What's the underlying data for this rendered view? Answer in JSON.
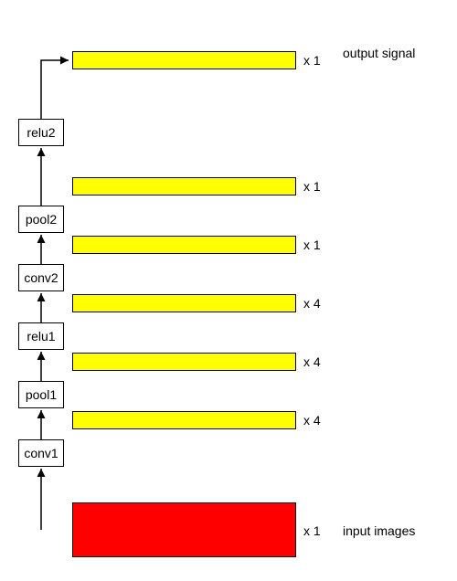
{
  "diagram": {
    "layers": {
      "conv1": "conv1",
      "pool1": "pool1",
      "relu1": "relu1",
      "conv2": "conv2",
      "pool2": "pool2",
      "relu2": "relu2"
    },
    "counts": {
      "input": "x 1",
      "after_conv1": "x 4",
      "after_pool1": "x 4",
      "after_relu1": "x 4",
      "after_conv2": "x 1",
      "after_pool2": "x 1",
      "output": "x 1"
    },
    "captions": {
      "input": "input images",
      "output": "output signal"
    }
  },
  "chart_data": {
    "type": "flow-diagram",
    "direction": "bottom-to-top",
    "nodes": [
      {
        "id": "input",
        "label": "input images",
        "channels": 1,
        "appearance": "large red box"
      },
      {
        "id": "conv1",
        "label": "conv1",
        "output_channels": 4
      },
      {
        "id": "pool1",
        "label": "pool1",
        "output_channels": 4
      },
      {
        "id": "relu1",
        "label": "relu1",
        "output_channels": 4
      },
      {
        "id": "conv2",
        "label": "conv2",
        "output_channels": 1
      },
      {
        "id": "pool2",
        "label": "pool2",
        "output_channels": 1
      },
      {
        "id": "relu2",
        "label": "relu2",
        "output_channels": 1
      },
      {
        "id": "output",
        "label": "output signal",
        "channels": 1,
        "appearance": "yellow bar"
      }
    ],
    "edges": [
      [
        "input",
        "conv1"
      ],
      [
        "conv1",
        "pool1"
      ],
      [
        "pool1",
        "relu1"
      ],
      [
        "relu1",
        "conv2"
      ],
      [
        "conv2",
        "pool2"
      ],
      [
        "pool2",
        "relu2"
      ],
      [
        "relu2",
        "output"
      ]
    ]
  }
}
